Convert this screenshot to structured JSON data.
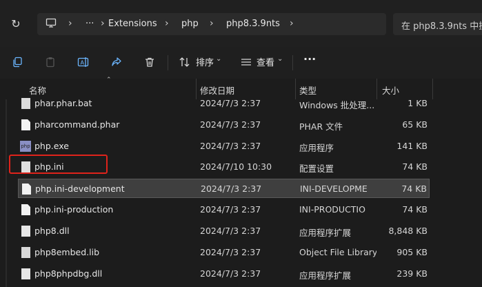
{
  "breadcrumb": {
    "more": "···",
    "items": [
      "Extensions",
      "php",
      "php8.3.9nts"
    ]
  },
  "search": {
    "placeholder": "在 php8.3.9nts 中搜"
  },
  "toolbar": {
    "sort_label": "排序",
    "view_label": "查看",
    "more": "···"
  },
  "columns": {
    "name": "名称",
    "date": "修改日期",
    "type": "类型",
    "size": "大小"
  },
  "files": [
    {
      "name": "phar.phar.bat",
      "date": "2024/7/3 2:37",
      "type": "Windows 批处理...",
      "size": "1 KB",
      "icon": "bat-file-icon"
    },
    {
      "name": "pharcommand.phar",
      "date": "2024/7/3 2:37",
      "type": "PHAR 文件",
      "size": "65 KB",
      "icon": "generic-file-icon"
    },
    {
      "name": "php.exe",
      "date": "2024/7/3 2:37",
      "type": "应用程序",
      "size": "141 KB",
      "icon": "php-exe-icon"
    },
    {
      "name": "php.ini",
      "date": "2024/7/10 10:30",
      "type": "配置设置",
      "size": "74 KB",
      "icon": "config-file-icon"
    },
    {
      "name": "php.ini-development",
      "date": "2024/7/3 2:37",
      "type": "INI-DEVELOPME",
      "size": "74 KB",
      "icon": "generic-file-icon"
    },
    {
      "name": "php.ini-production",
      "date": "2024/7/3 2:37",
      "type": "INI-PRODUCTIO",
      "size": "74 KB",
      "icon": "generic-file-icon"
    },
    {
      "name": "php8.dll",
      "date": "2024/7/3 2:37",
      "type": "应用程序扩展",
      "size": "8,848 KB",
      "icon": "dll-file-icon"
    },
    {
      "name": "php8embed.lib",
      "date": "2024/7/3 2:37",
      "type": "Object File Library",
      "size": "905 KB",
      "icon": "lib-file-icon"
    },
    {
      "name": "php8phpdbg.dll",
      "date": "2024/7/3 2:37",
      "type": "应用程序扩展",
      "size": "239 KB",
      "icon": "dll-file-icon"
    }
  ],
  "colors": {
    "accent": "#6cb6ff",
    "highlight_box": "#e0231b",
    "selected_row": "#3f3f3f"
  }
}
